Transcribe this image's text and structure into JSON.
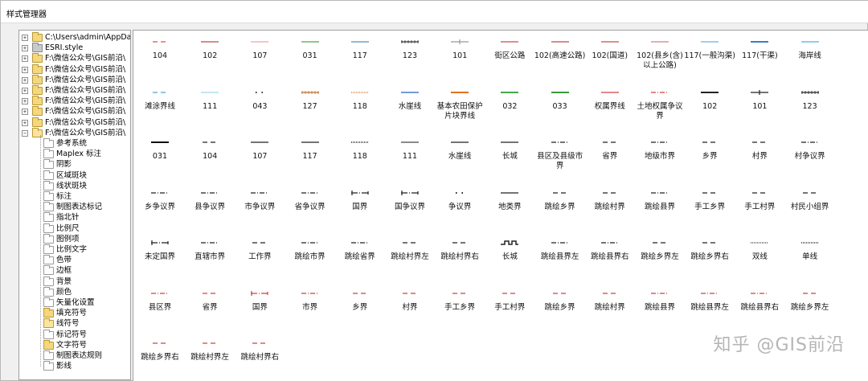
{
  "window": {
    "title": "样式管理器"
  },
  "tree": {
    "root_items": [
      {
        "label": "C:\\Users\\admin\\AppData\\",
        "type": "folder",
        "expander": "+"
      },
      {
        "label": "ESRI.style",
        "type": "style",
        "expander": "+"
      },
      {
        "label": "F:\\微信公众号\\GIS前沿\\",
        "type": "folder",
        "expander": "+"
      },
      {
        "label": "F:\\微信公众号\\GIS前沿\\",
        "type": "folder",
        "expander": "+"
      },
      {
        "label": "F:\\微信公众号\\GIS前沿\\",
        "type": "folder",
        "expander": "+"
      },
      {
        "label": "F:\\微信公众号\\GIS前沿\\",
        "type": "folder",
        "expander": "+"
      },
      {
        "label": "F:\\微信公众号\\GIS前沿\\",
        "type": "folder",
        "expander": "+"
      },
      {
        "label": "F:\\微信公众号\\GIS前沿\\",
        "type": "folder",
        "expander": "+"
      },
      {
        "label": "F:\\微信公众号\\GIS前沿\\",
        "type": "folder",
        "expander": "+"
      },
      {
        "label": "F:\\微信公众号\\GIS前沿\\",
        "type": "folder-open",
        "expander": "−"
      }
    ],
    "children": [
      {
        "label": "参考系统",
        "type": "white"
      },
      {
        "label": "Maplex 标注",
        "type": "white"
      },
      {
        "label": "阴影",
        "type": "white"
      },
      {
        "label": "区域斑块",
        "type": "white"
      },
      {
        "label": "线状斑块",
        "type": "white"
      },
      {
        "label": "标注",
        "type": "white"
      },
      {
        "label": "制图表达标记",
        "type": "white"
      },
      {
        "label": "指北针",
        "type": "white"
      },
      {
        "label": "比例尺",
        "type": "white"
      },
      {
        "label": "图例项",
        "type": "white"
      },
      {
        "label": "比例文字",
        "type": "white"
      },
      {
        "label": "色带",
        "type": "white"
      },
      {
        "label": "边框",
        "type": "white"
      },
      {
        "label": "背景",
        "type": "white"
      },
      {
        "label": "颜色",
        "type": "white"
      },
      {
        "label": "矢量化设置",
        "type": "white"
      },
      {
        "label": "填充符号",
        "type": "yellow"
      },
      {
        "label": "线符号",
        "type": "open"
      },
      {
        "label": "标记符号",
        "type": "white"
      },
      {
        "label": "文字符号",
        "type": "yellow"
      },
      {
        "label": "制图表达规则",
        "type": "white"
      },
      {
        "label": "影线",
        "type": "white"
      }
    ]
  },
  "symbols": [
    {
      "label": "104",
      "style": "dash",
      "color": "#d9534f"
    },
    {
      "label": "102",
      "style": "solid",
      "color": "#b94a48"
    },
    {
      "label": "107",
      "style": "solid",
      "color": "#f0a0a0"
    },
    {
      "label": "031",
      "style": "solid",
      "color": "#4aa84a"
    },
    {
      "label": "117",
      "style": "solid",
      "color": "#4a90c8"
    },
    {
      "label": "123",
      "style": "ticks",
      "color": "#333333"
    },
    {
      "label": "101",
      "style": "cross",
      "color": "#999999"
    },
    {
      "label": "街区公路",
      "style": "solid",
      "color": "#c0504d"
    },
    {
      "label": "102(高速公路)",
      "style": "solid",
      "color": "#b94a48"
    },
    {
      "label": "102(国道)",
      "style": "solid",
      "color": "#c0504d"
    },
    {
      "label": "102(县乡(含)以上公路)",
      "style": "solid",
      "color": "#d08080"
    },
    {
      "label": "117(一般沟渠)",
      "style": "solid",
      "color": "#6ab0e0"
    },
    {
      "label": "117(干渠)",
      "style": "thick",
      "color": "#3a80c0"
    },
    {
      "label": "海岸线",
      "style": "solid",
      "color": "#4ab0e0"
    },
    {
      "label": "滩涂界线",
      "style": "dash",
      "color": "#4aa0d8"
    },
    {
      "label": "111",
      "style": "solid",
      "color": "#a0d8f0"
    },
    {
      "label": "043",
      "style": "dots",
      "color": "#333333"
    },
    {
      "label": "127",
      "style": "ticks",
      "color": "#c07030"
    },
    {
      "label": "118",
      "style": "dotted",
      "color": "#e08040"
    },
    {
      "label": "水崖线",
      "style": "solid",
      "color": "#2060c0"
    },
    {
      "label": "基本农田保护片块界线",
      "style": "thick",
      "color": "#e07020"
    },
    {
      "label": "032",
      "style": "thick",
      "color": "#4aa84a"
    },
    {
      "label": "033",
      "style": "thick",
      "color": "#3a9a3a"
    },
    {
      "label": "权属界线",
      "style": "solid",
      "color": "#d04040"
    },
    {
      "label": "土地权属争议界",
      "style": "dashdot",
      "color": "#d04040"
    },
    {
      "label": "102",
      "style": "thick",
      "color": "#222222"
    },
    {
      "label": "101",
      "style": "cross",
      "color": "#222222"
    },
    {
      "label": "123",
      "style": "ticks",
      "color": "#222222"
    },
    {
      "label": "031",
      "style": "thick",
      "color": "#111111"
    },
    {
      "label": "104",
      "style": "dash",
      "color": "#222222"
    },
    {
      "label": "107",
      "style": "solid",
      "color": "#222222"
    },
    {
      "label": "117",
      "style": "solid",
      "color": "#222222"
    },
    {
      "label": "118",
      "style": "dotted",
      "color": "#222222"
    },
    {
      "label": "111",
      "style": "solid",
      "color": "#444444"
    },
    {
      "label": "水崖线",
      "style": "solid",
      "color": "#222222"
    },
    {
      "label": "长城",
      "style": "solid",
      "color": "#222222"
    },
    {
      "label": "县区及县级市界",
      "style": "dashdot",
      "color": "#222222"
    },
    {
      "label": "省界",
      "style": "dash",
      "color": "#222222"
    },
    {
      "label": "地级市界",
      "style": "dashdot",
      "color": "#222222"
    },
    {
      "label": "乡界",
      "style": "dash",
      "color": "#222222"
    },
    {
      "label": "村界",
      "style": "dash",
      "color": "#222222"
    },
    {
      "label": "村争议界",
      "style": "dashdot",
      "color": "#222222"
    },
    {
      "label": "乡争议界",
      "style": "dashdot",
      "color": "#222222"
    },
    {
      "label": "县争议界",
      "style": "dashdot",
      "color": "#222222"
    },
    {
      "label": "市争议界",
      "style": "dashdot",
      "color": "#222222"
    },
    {
      "label": "省争议界",
      "style": "dashdot",
      "color": "#222222"
    },
    {
      "label": "国界",
      "style": "border",
      "color": "#222222"
    },
    {
      "label": "国争议界",
      "style": "border",
      "color": "#222222"
    },
    {
      "label": "争议界",
      "style": "dots",
      "color": "#222222"
    },
    {
      "label": "地类界",
      "style": "solid",
      "color": "#222222"
    },
    {
      "label": "跳绘乡界",
      "style": "dash",
      "color": "#222222"
    },
    {
      "label": "跳绘村界",
      "style": "dash",
      "color": "#222222"
    },
    {
      "label": "跳绘县界",
      "style": "dashdot",
      "color": "#222222"
    },
    {
      "label": "手工乡界",
      "style": "dash",
      "color": "#222222"
    },
    {
      "label": "手工村界",
      "style": "dash",
      "color": "#222222"
    },
    {
      "label": "村民小组界",
      "style": "dash",
      "color": "#222222"
    },
    {
      "label": "未定国界",
      "style": "border",
      "color": "#222222"
    },
    {
      "label": "直辖市界",
      "style": "dashdot",
      "color": "#222222"
    },
    {
      "label": "工作界",
      "style": "dash",
      "color": "#222222"
    },
    {
      "label": "跳绘市界",
      "style": "dashdot",
      "color": "#222222"
    },
    {
      "label": "跳绘省界",
      "style": "dashdot",
      "color": "#222222"
    },
    {
      "label": "跳绘村界左",
      "style": "dash",
      "color": "#222222"
    },
    {
      "label": "跳绘村界右",
      "style": "dash",
      "color": "#222222"
    },
    {
      "label": "长城",
      "style": "wall",
      "color": "#222222"
    },
    {
      "label": "跳绘县界左",
      "style": "dashdot",
      "color": "#222222"
    },
    {
      "label": "跳绘县界右",
      "style": "dashdot",
      "color": "#222222"
    },
    {
      "label": "跳绘乡界左",
      "style": "dash",
      "color": "#222222"
    },
    {
      "label": "跳绘乡界右",
      "style": "dash",
      "color": "#222222"
    },
    {
      "label": "双线",
      "style": "dotted",
      "color": "#555555"
    },
    {
      "label": "单线",
      "style": "dotted",
      "color": "#333333"
    },
    {
      "label": "县区界",
      "style": "dashdot",
      "color": "#d04040"
    },
    {
      "label": "省界",
      "style": "dash",
      "color": "#d04040"
    },
    {
      "label": "国界",
      "style": "border",
      "color": "#d04040"
    },
    {
      "label": "市界",
      "style": "dashdot",
      "color": "#d04040"
    },
    {
      "label": "乡界",
      "style": "dash",
      "color": "#d04040"
    },
    {
      "label": "村界",
      "style": "dash",
      "color": "#d04040"
    },
    {
      "label": "手工乡界",
      "style": "dash",
      "color": "#d04040"
    },
    {
      "label": "手工村界",
      "style": "dash",
      "color": "#d04040"
    },
    {
      "label": "跳绘乡界",
      "style": "dash",
      "color": "#d04040"
    },
    {
      "label": "跳绘村界",
      "style": "dash",
      "color": "#d04040"
    },
    {
      "label": "跳绘县界",
      "style": "dashdot",
      "color": "#d04040"
    },
    {
      "label": "跳绘县界左",
      "style": "dashdot",
      "color": "#d04040"
    },
    {
      "label": "跳绘县界右",
      "style": "dashdot",
      "color": "#d04040"
    },
    {
      "label": "跳绘乡界左",
      "style": "dash",
      "color": "#d04040"
    },
    {
      "label": "跳绘乡界右",
      "style": "dash",
      "color": "#d04040"
    },
    {
      "label": "跳绘村界左",
      "style": "dash",
      "color": "#d04040"
    },
    {
      "label": "跳绘村界右",
      "style": "dash",
      "color": "#d04040"
    }
  ],
  "watermark": {
    "text": "知乎 @GIS前沿",
    "icon": "zhihu-logo-icon"
  }
}
